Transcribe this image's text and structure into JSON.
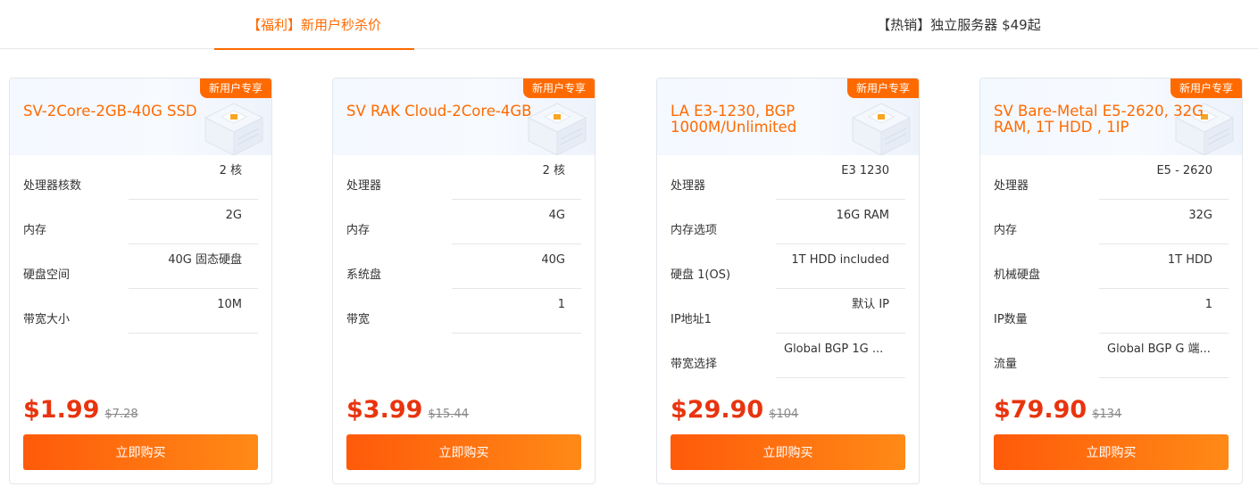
{
  "tabs": [
    {
      "label": "【福利】新用户秒杀价",
      "active": true
    },
    {
      "label": "【热销】独立服务器 $49起",
      "active": false
    }
  ],
  "colors": {
    "accent": "#ff6a00",
    "price": "#e8340f",
    "badge": "#ff6a00"
  },
  "cards": [
    {
      "badge": "新用户专享",
      "title": "SV-2Core-2GB-40G SSD",
      "specs": [
        {
          "label": "处理器核数",
          "value": "2 核"
        },
        {
          "label": "内存",
          "value": "2G"
        },
        {
          "label": "硬盘空间",
          "value": "40G 固态硬盘"
        },
        {
          "label": "带宽大小",
          "value": "10M"
        }
      ],
      "price": "$1.99",
      "old_price": "$7.28",
      "buy_label": "立即购买"
    },
    {
      "badge": "新用户专享",
      "title": "SV RAK Cloud-2Core-4GB",
      "specs": [
        {
          "label": "处理器",
          "value": "2 核"
        },
        {
          "label": "内存",
          "value": "4G"
        },
        {
          "label": "系统盘",
          "value": "40G"
        },
        {
          "label": "带宽",
          "value": "1"
        }
      ],
      "price": "$3.99",
      "old_price": "$15.44",
      "buy_label": "立即购买"
    },
    {
      "badge": "新用户专享",
      "title": "LA E3-1230, BGP 1000M/Unlimited",
      "specs": [
        {
          "label": "处理器",
          "value": "E3 1230"
        },
        {
          "label": "内存选项",
          "value": "16G RAM"
        },
        {
          "label": "硬盘 1(OS)",
          "value": "1T HDD included"
        },
        {
          "label": "IP地址1",
          "value": "默认 IP"
        },
        {
          "label": "带宽选择",
          "value": "Global BGP 1G ..."
        }
      ],
      "price": "$29.90",
      "old_price": "$104",
      "buy_label": "立即购买"
    },
    {
      "badge": "新用户专享",
      "title": "SV Bare-Metal E5-2620, 32G RAM, 1T HDD , 1IP",
      "specs": [
        {
          "label": "处理器",
          "value": "E5 - 2620"
        },
        {
          "label": "内存",
          "value": "32G"
        },
        {
          "label": "机械硬盘",
          "value": "1T HDD"
        },
        {
          "label": "IP数量",
          "value": "1"
        },
        {
          "label": "流量",
          "value": "Global BGP G 端..."
        }
      ],
      "price": "$79.90",
      "old_price": "$134",
      "buy_label": "立即购买"
    }
  ]
}
